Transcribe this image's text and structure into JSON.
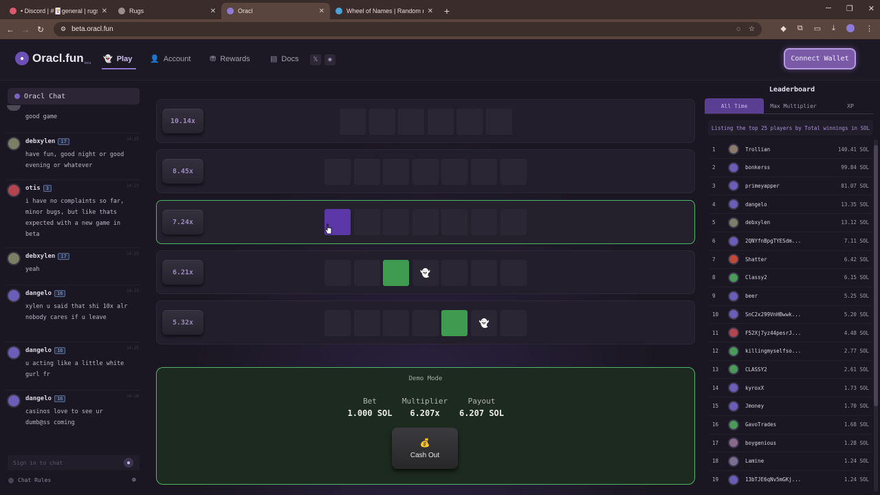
{
  "browser": {
    "tabs": [
      {
        "title": "• Discord | #🃏general | rugs.",
        "color": "#e0596a",
        "active": false
      },
      {
        "title": "Rugs",
        "color": "#9a8f8a",
        "active": false
      },
      {
        "title": "Oracl",
        "color": "#8f7ad6",
        "active": true
      },
      {
        "title": "Wheel of Names | Random nam",
        "color": "#4aa3d8",
        "active": false
      }
    ],
    "url": "beta.oracl.fun"
  },
  "header": {
    "logo": "Oracl.fun",
    "logo_badge": "beta",
    "nav": [
      {
        "label": "Play",
        "icon": "ghost-icon",
        "active": true
      },
      {
        "label": "Account",
        "icon": "user-icon",
        "active": false
      },
      {
        "label": "Rewards",
        "icon": "coins-icon",
        "active": false
      },
      {
        "label": "Docs",
        "icon": "document-icon",
        "active": false
      }
    ],
    "connect_wallet": "Connect Wallet"
  },
  "chat": {
    "title": "Oracl Chat",
    "messages": [
      {
        "name": "",
        "level": "",
        "time": "",
        "text": "good game",
        "avatar": "#4e4a58"
      },
      {
        "name": "debxylen",
        "level": "17",
        "time": "14:25",
        "text": "have fun, good night or good evening or whatever",
        "avatar": "#7a8066"
      },
      {
        "name": "otis",
        "level": "3",
        "time": "14:25",
        "text": "i have no complaints so far, minor bugs, but like thats expected with a new game in beta",
        "avatar": "#b4454f"
      },
      {
        "name": "debxylen",
        "level": "17",
        "time": "14:25",
        "text": "yeah",
        "avatar": "#7a8066"
      },
      {
        "name": "dangelo",
        "level": "16",
        "time": "14:25",
        "text": "xylen u said that shi 10x alr nobody cares if u leave",
        "avatar": "#6a5fb8"
      },
      {
        "name": "dangelo",
        "level": "16",
        "time": "14:25",
        "text": "u acting like a little white gurl fr",
        "avatar": "#6a5fb8"
      },
      {
        "name": "dangelo",
        "level": "16",
        "time": "14:26",
        "text": "casinos love to see ur dumb@ss coming",
        "avatar": "#6a5fb8"
      }
    ],
    "input_placeholder": "Sign in to chat",
    "rules": "Chat Rules"
  },
  "game": {
    "rows": [
      {
        "multiplier": "10.14x",
        "tiles": 6,
        "start": 0,
        "active": false,
        "cells": {}
      },
      {
        "multiplier": "8.45x",
        "tiles": 7,
        "start": 0,
        "active": false,
        "cells": {}
      },
      {
        "multiplier": "7.24x",
        "tiles": 7,
        "start": 0,
        "active": true,
        "cells": {
          "0": "purple"
        }
      },
      {
        "multiplier": "6.21x",
        "tiles": 7,
        "start": 0,
        "active": false,
        "cells": {
          "2": "green",
          "3": "ghost"
        }
      },
      {
        "multiplier": "5.32x",
        "tiles": 7,
        "start": 0,
        "active": false,
        "cells": {
          "4": "green",
          "5": "ghost"
        }
      }
    ],
    "demo": {
      "title": "Demo Mode",
      "bet_label": "Bet",
      "bet_value": "1.000 SOL",
      "mult_label": "Multiplier",
      "mult_value": "6.207x",
      "payout_label": "Payout",
      "payout_value": "6.207 SOL",
      "cashout": "Cash Out"
    }
  },
  "leaderboard": {
    "title": "Leaderboard",
    "tabs": [
      "All Time",
      "Max Multiplier",
      "XP"
    ],
    "info": "Listing the top 25 players by Total winnings in SOL",
    "rows": [
      {
        "rank": "1",
        "name": "Trollian",
        "amount": "140.41 SOL",
        "avatar": "#8c7a6a"
      },
      {
        "rank": "2",
        "name": "bonkerss",
        "amount": "99.84 SOL",
        "avatar": "#6a5fb8"
      },
      {
        "rank": "3",
        "name": "primeyapper",
        "amount": "81.07 SOL",
        "avatar": "#6a5fb8"
      },
      {
        "rank": "4",
        "name": "dangelo",
        "amount": "13.35 SOL",
        "avatar": "#6a5fb8"
      },
      {
        "rank": "5",
        "name": "debxylen",
        "amount": "13.12 SOL",
        "avatar": "#7a8066"
      },
      {
        "rank": "6",
        "name": "2QNYfnBpgTYESdm...",
        "amount": "7.11 SOL",
        "avatar": "#6a5fb8"
      },
      {
        "rank": "7",
        "name": "Shatter",
        "amount": "6.42 SOL",
        "avatar": "#c04a3a"
      },
      {
        "rank": "8",
        "name": "Classy2",
        "amount": "6.15 SOL",
        "avatar": "#4a9a5a"
      },
      {
        "rank": "9",
        "name": "beer",
        "amount": "5.25 SOL",
        "avatar": "#6a5fb8"
      },
      {
        "rank": "10",
        "name": "SnC2x299VnHBwwk...",
        "amount": "5.20 SOL",
        "avatar": "#6a5fb8"
      },
      {
        "rank": "11",
        "name": "F52Xj7yz44pesrJ...",
        "amount": "4.48 SOL",
        "avatar": "#b4454f"
      },
      {
        "rank": "12",
        "name": "killingmyselfso...",
        "amount": "2.77 SOL",
        "avatar": "#4a9a5a"
      },
      {
        "rank": "13",
        "name": "CLASSY2",
        "amount": "2.61 SOL",
        "avatar": "#4a9a5a"
      },
      {
        "rank": "14",
        "name": "kyroxX",
        "amount": "1.73 SOL",
        "avatar": "#6a5fb8"
      },
      {
        "rank": "15",
        "name": "Jmoney",
        "amount": "1.70 SOL",
        "avatar": "#6a5fb8"
      },
      {
        "rank": "16",
        "name": "GavoTrades",
        "amount": "1.68 SOL",
        "avatar": "#4a9a5a"
      },
      {
        "rank": "17",
        "name": "boygenious",
        "amount": "1.28 SOL",
        "avatar": "#8a6a8a"
      },
      {
        "rank": "18",
        "name": "Lamine",
        "amount": "1.24 SOL",
        "avatar": "#7a7090"
      },
      {
        "rank": "19",
        "name": "13bTJE6qNv5mGKj...",
        "amount": "1.24 SOL",
        "avatar": "#6a5fb8"
      }
    ]
  }
}
